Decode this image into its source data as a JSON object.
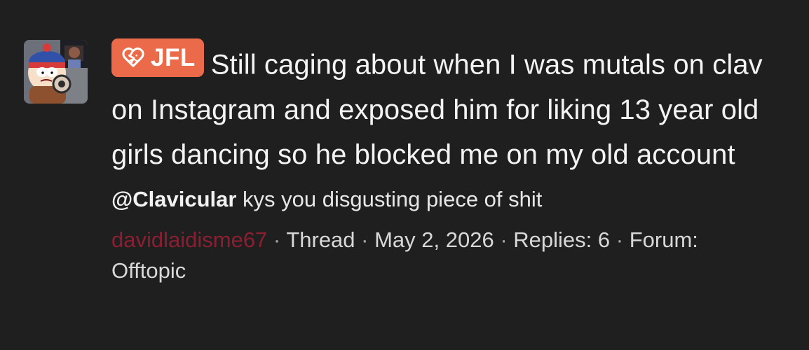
{
  "thread": {
    "prefix": "JFL",
    "title": "Still caging about when I was mutals on clav on Instagram and exposed him for liking 13 year old girls dancing so he blocked me on my old account",
    "snippet_mention": "@Clavicular",
    "snippet_text": " kys you disgusting piece of shit",
    "author": "davidlaidisme67",
    "separator": " · ",
    "type": "Thread",
    "date": "May 2, 2026",
    "replies": "Replies: 6",
    "forum_label": "Forum:",
    "forum": "Offtopic",
    "icon": "broken-heart-sad-icon",
    "colors": {
      "background": "#1f1f1f",
      "badge": "#eb6a4a",
      "author": "#8a1f32"
    }
  }
}
